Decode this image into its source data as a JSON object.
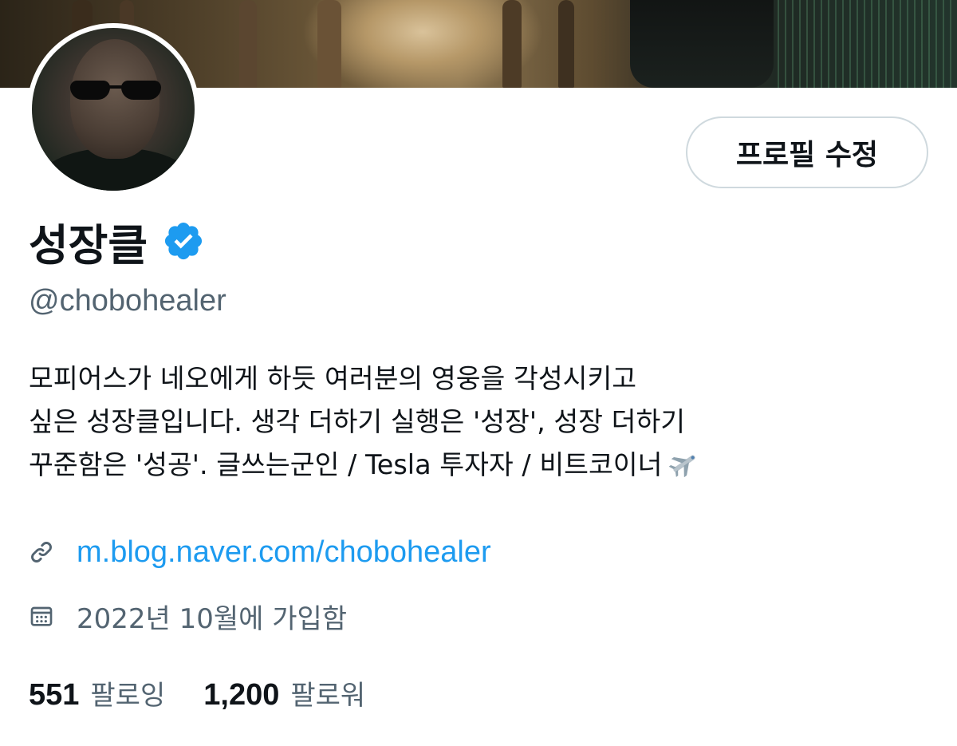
{
  "profile": {
    "edit_button_label": "프로필 수정",
    "display_name": "성장클",
    "handle": "@chobohealer",
    "verified": true,
    "bio_lines": [
      "모피어스가 네오에게 하듯 여러분의 영웅을 각성시키고",
      "싶은 성장클입니다. 생각 더하기 실행은 '성장', 성장 더하기",
      "꾸준함은 '성공'. 글쓰는군인 / Tesla 투자자 / 비트코이너"
    ],
    "bio_emoji": "airplane-emoji",
    "link_text": "m.blog.naver.com/chobohealer",
    "joined_text": "2022년 10월에 가입함",
    "following_count": "551",
    "following_label": "팔로잉",
    "followers_count": "1,200",
    "followers_label": "팔로워"
  },
  "icons": {
    "verified": "verified-badge-icon",
    "link": "link-icon",
    "calendar": "calendar-icon"
  },
  "colors": {
    "text_primary": "#0f1419",
    "text_secondary": "#536471",
    "link": "#1d9bf0",
    "verified": "#1d9bf0",
    "button_border": "#cfd9de"
  }
}
